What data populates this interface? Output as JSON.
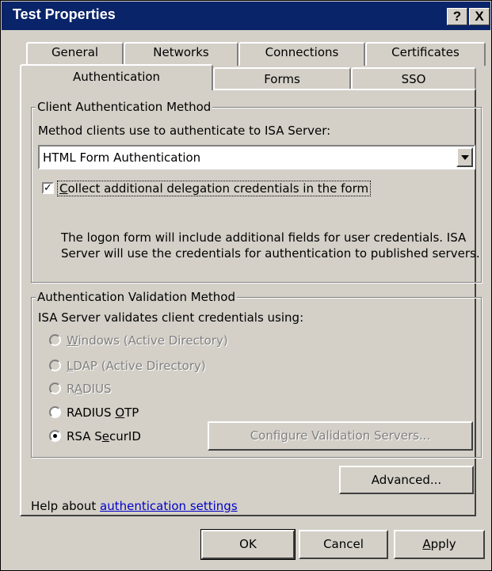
{
  "window": {
    "title": "Test Properties"
  },
  "titlebar_buttons": {
    "help": "?",
    "close": "X"
  },
  "tabs_row1": [
    "General",
    "Networks",
    "Connections",
    "Certificates"
  ],
  "tabs_row2": [
    "Authentication",
    "Forms",
    "SSO"
  ],
  "selected_tab": "Authentication",
  "client_auth": {
    "group_label": "Client Authentication Method",
    "prompt": "Method clients use to authenticate to ISA Server:",
    "selected_method": "HTML Form Authentication",
    "checkbox_label_first": "C",
    "checkbox_label_rest": "ollect additional delegation credentials in the form",
    "checkbox_checked": true,
    "checkbox_mark": "✓",
    "description_line1": "The logon form will include additional fields for user credentials. ISA",
    "description_line2": "Server will use the credentials for authentication to published servers."
  },
  "validation": {
    "group_label": "Authentication Validation Method",
    "prompt": "ISA Server validates client credentials using:",
    "options": [
      {
        "pre": "",
        "accel": "W",
        "post": "indows (Active Directory)",
        "enabled": false,
        "selected": false
      },
      {
        "pre": "",
        "accel": "L",
        "post": "DAP (Active Directory)",
        "enabled": false,
        "selected": false
      },
      {
        "pre": "R",
        "accel": "A",
        "post": "DIUS",
        "enabled": false,
        "selected": false
      },
      {
        "pre": "RADIUS ",
        "accel": "O",
        "post": "TP",
        "enabled": true,
        "selected": false
      },
      {
        "pre": "RSA S",
        "accel": "e",
        "post": "curID",
        "enabled": true,
        "selected": true
      }
    ],
    "configure_button": "Configure Validation Servers..."
  },
  "advanced_button": "Advanced...",
  "help": {
    "prefix": "Help about ",
    "link": "authentication settings"
  },
  "buttons": {
    "ok": "OK",
    "cancel": "Cancel",
    "apply_accel": "A",
    "apply_rest": "pply"
  }
}
